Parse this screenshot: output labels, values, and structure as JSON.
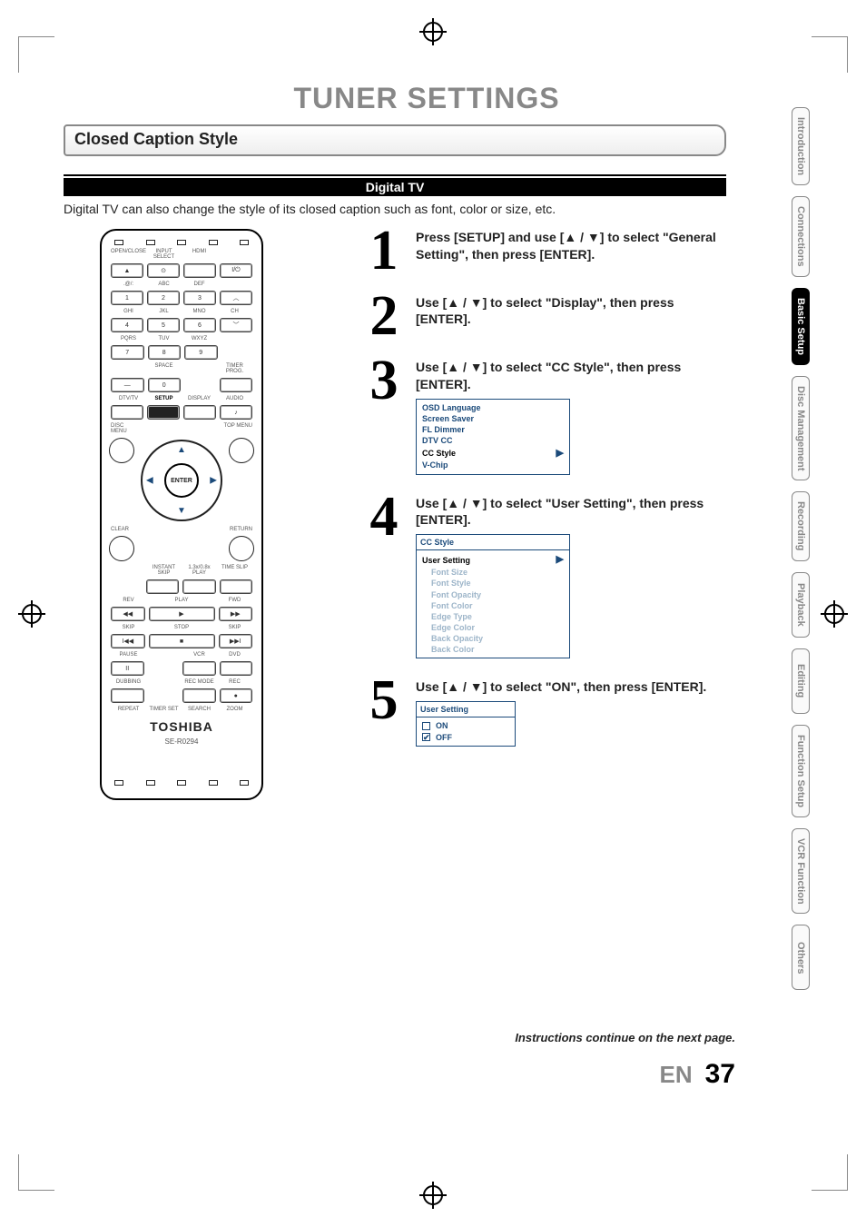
{
  "page": {
    "title": "TUNER SETTINGS",
    "section_heading": "Closed Caption Style",
    "sub_band": "Digital TV",
    "intro": "Digital TV can also change the style of its closed caption such as font, color or size, etc.",
    "continue_note": "Instructions continue on the next page.",
    "lang": "EN",
    "page_number": "37"
  },
  "tabs": [
    {
      "label": "Introduction",
      "active": false
    },
    {
      "label": "Connections",
      "active": false
    },
    {
      "label": "Basic Setup",
      "active": true
    },
    {
      "label": "Disc Management",
      "active": false
    },
    {
      "label": "Recording",
      "active": false
    },
    {
      "label": "Playback",
      "active": false
    },
    {
      "label": "Editing",
      "active": false
    },
    {
      "label": "Function Setup",
      "active": false
    },
    {
      "label": "VCR Function",
      "active": false
    },
    {
      "label": "Others",
      "active": false
    }
  ],
  "remote": {
    "brand": "TOSHIBA",
    "model": "SE-R0294",
    "caps": {
      "row1": [
        "OPEN/CLOSE",
        "INPUT SELECT",
        "HDMI",
        ""
      ],
      "row2": [
        ".@/:",
        "ABC",
        "DEF",
        ""
      ],
      "row3": [
        "GHI",
        "JKL",
        "MNO",
        "CH"
      ],
      "row4": [
        "PQRS",
        "TUV",
        "WXYZ",
        ""
      ],
      "row5": [
        "",
        "SPACE",
        "",
        "TIMER PROG."
      ],
      "row6": [
        "DTV/TV",
        "SETUP",
        "DISPLAY",
        "AUDIO"
      ],
      "row7": [
        "DISC MENU",
        "",
        "",
        "TOP MENU"
      ],
      "row8": [
        "CLEAR",
        "",
        "",
        "RETURN"
      ],
      "row9": [
        "",
        "INSTANT SKIP",
        "1.3x/0.8x PLAY",
        "TIME SLIP"
      ],
      "row10": [
        "REV",
        "PLAY",
        "",
        "FWD"
      ],
      "row11": [
        "SKIP",
        "STOP",
        "",
        "SKIP"
      ],
      "row12": [
        "PAUSE",
        "",
        "VCR",
        "DVD"
      ],
      "row13": [
        "DUBBING",
        "",
        "REC MODE",
        "REC"
      ],
      "row14": [
        "REPEAT",
        "TIMER SET",
        "SEARCH",
        "ZOOM"
      ]
    },
    "keys": {
      "open": "▲",
      "input": "⊙",
      "hdmi": "",
      "power": "I/⏻",
      "n1": "1",
      "n2": "2",
      "n3": "3",
      "chup": "︿",
      "n4": "4",
      "n5": "5",
      "n6": "6",
      "chdn": "﹀",
      "n7": "7",
      "n8": "8",
      "n9": "9",
      "dash": "—",
      "n0": "0",
      "audio": "♪",
      "enter": "ENTER",
      "rev": "◀◀",
      "play": "▶",
      "fwd": "▶▶",
      "skipb": "I◀◀",
      "stop": "■",
      "skipf": "▶▶I",
      "pause": "II",
      "rec": "●"
    }
  },
  "steps": [
    {
      "num": "1",
      "text": "Press [SETUP] and use [▲ / ▼] to select \"General Setting\", then press [ENTER]."
    },
    {
      "num": "2",
      "text": "Use [▲ / ▼] to select \"Display\", then press [ENTER]."
    },
    {
      "num": "3",
      "text": "Use [▲ / ▼] to select \"CC Style\", then press [ENTER].",
      "osd": {
        "items": [
          "OSD Language",
          "Screen Saver",
          "FL Dimmer",
          "DTV CC",
          "CC Style",
          "V-Chip"
        ],
        "selected": "CC Style"
      }
    },
    {
      "num": "4",
      "text": "Use [▲ / ▼] to select \"User Setting\", then press [ENTER].",
      "osd": {
        "title": "CC Style",
        "selected": "User Setting",
        "subitems": [
          "Font Size",
          "Font Style",
          "Font Opacity",
          "Font Color",
          "Edge Type",
          "Edge Color",
          "Back Opacity",
          "Back Color"
        ]
      }
    },
    {
      "num": "5",
      "text": "Use [▲ / ▼] to select \"ON\", then press [ENTER].",
      "osd": {
        "title": "User Setting",
        "options": [
          {
            "label": "ON",
            "checked": false
          },
          {
            "label": "OFF",
            "checked": true
          }
        ]
      }
    }
  ]
}
